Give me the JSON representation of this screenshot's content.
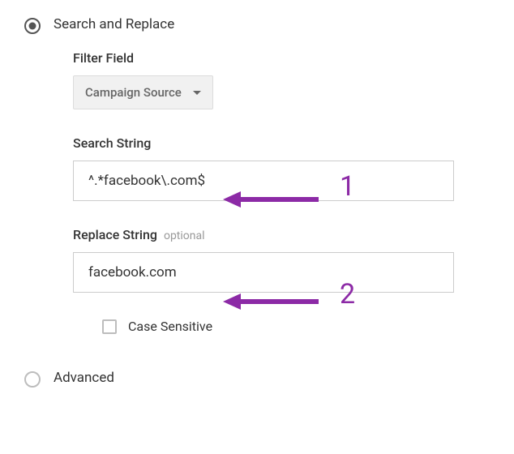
{
  "options": {
    "search_replace_label": "Search and Replace",
    "advanced_label": "Advanced"
  },
  "fields": {
    "filter_field": {
      "label": "Filter Field",
      "value": "Campaign Source"
    },
    "search_string": {
      "label": "Search String",
      "value": "^.*facebook\\.com$"
    },
    "replace_string": {
      "label": "Replace String",
      "optional": "optional",
      "value": "facebook.com"
    },
    "case_sensitive": {
      "label": "Case Sensitive"
    }
  },
  "annotations": {
    "one": "1",
    "two": "2",
    "color": "#8c2aa6"
  }
}
